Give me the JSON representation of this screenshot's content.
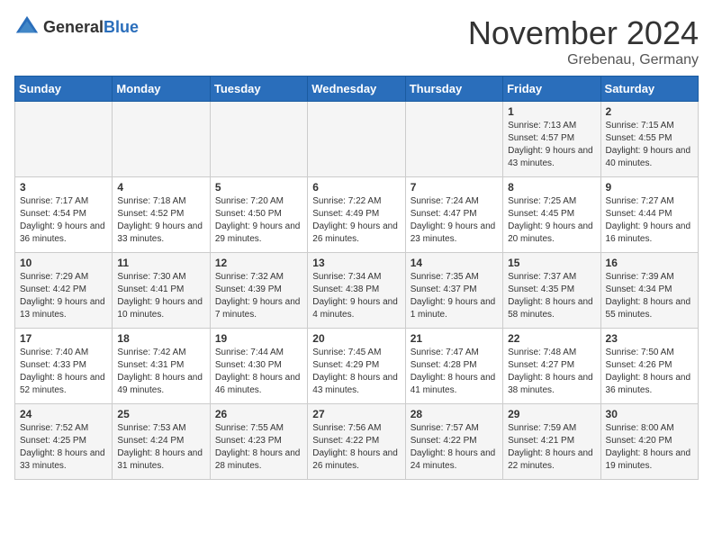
{
  "header": {
    "logo_general": "General",
    "logo_blue": "Blue",
    "month": "November 2024",
    "location": "Grebenau, Germany"
  },
  "weekdays": [
    "Sunday",
    "Monday",
    "Tuesday",
    "Wednesday",
    "Thursday",
    "Friday",
    "Saturday"
  ],
  "weeks": [
    [
      {
        "day": "",
        "sunrise": "",
        "sunset": "",
        "daylight": ""
      },
      {
        "day": "",
        "sunrise": "",
        "sunset": "",
        "daylight": ""
      },
      {
        "day": "",
        "sunrise": "",
        "sunset": "",
        "daylight": ""
      },
      {
        "day": "",
        "sunrise": "",
        "sunset": "",
        "daylight": ""
      },
      {
        "day": "",
        "sunrise": "",
        "sunset": "",
        "daylight": ""
      },
      {
        "day": "1",
        "sunrise": "Sunrise: 7:13 AM",
        "sunset": "Sunset: 4:57 PM",
        "daylight": "Daylight: 9 hours and 43 minutes."
      },
      {
        "day": "2",
        "sunrise": "Sunrise: 7:15 AM",
        "sunset": "Sunset: 4:55 PM",
        "daylight": "Daylight: 9 hours and 40 minutes."
      }
    ],
    [
      {
        "day": "3",
        "sunrise": "Sunrise: 7:17 AM",
        "sunset": "Sunset: 4:54 PM",
        "daylight": "Daylight: 9 hours and 36 minutes."
      },
      {
        "day": "4",
        "sunrise": "Sunrise: 7:18 AM",
        "sunset": "Sunset: 4:52 PM",
        "daylight": "Daylight: 9 hours and 33 minutes."
      },
      {
        "day": "5",
        "sunrise": "Sunrise: 7:20 AM",
        "sunset": "Sunset: 4:50 PM",
        "daylight": "Daylight: 9 hours and 29 minutes."
      },
      {
        "day": "6",
        "sunrise": "Sunrise: 7:22 AM",
        "sunset": "Sunset: 4:49 PM",
        "daylight": "Daylight: 9 hours and 26 minutes."
      },
      {
        "day": "7",
        "sunrise": "Sunrise: 7:24 AM",
        "sunset": "Sunset: 4:47 PM",
        "daylight": "Daylight: 9 hours and 23 minutes."
      },
      {
        "day": "8",
        "sunrise": "Sunrise: 7:25 AM",
        "sunset": "Sunset: 4:45 PM",
        "daylight": "Daylight: 9 hours and 20 minutes."
      },
      {
        "day": "9",
        "sunrise": "Sunrise: 7:27 AM",
        "sunset": "Sunset: 4:44 PM",
        "daylight": "Daylight: 9 hours and 16 minutes."
      }
    ],
    [
      {
        "day": "10",
        "sunrise": "Sunrise: 7:29 AM",
        "sunset": "Sunset: 4:42 PM",
        "daylight": "Daylight: 9 hours and 13 minutes."
      },
      {
        "day": "11",
        "sunrise": "Sunrise: 7:30 AM",
        "sunset": "Sunset: 4:41 PM",
        "daylight": "Daylight: 9 hours and 10 minutes."
      },
      {
        "day": "12",
        "sunrise": "Sunrise: 7:32 AM",
        "sunset": "Sunset: 4:39 PM",
        "daylight": "Daylight: 9 hours and 7 minutes."
      },
      {
        "day": "13",
        "sunrise": "Sunrise: 7:34 AM",
        "sunset": "Sunset: 4:38 PM",
        "daylight": "Daylight: 9 hours and 4 minutes."
      },
      {
        "day": "14",
        "sunrise": "Sunrise: 7:35 AM",
        "sunset": "Sunset: 4:37 PM",
        "daylight": "Daylight: 9 hours and 1 minute."
      },
      {
        "day": "15",
        "sunrise": "Sunrise: 7:37 AM",
        "sunset": "Sunset: 4:35 PM",
        "daylight": "Daylight: 8 hours and 58 minutes."
      },
      {
        "day": "16",
        "sunrise": "Sunrise: 7:39 AM",
        "sunset": "Sunset: 4:34 PM",
        "daylight": "Daylight: 8 hours and 55 minutes."
      }
    ],
    [
      {
        "day": "17",
        "sunrise": "Sunrise: 7:40 AM",
        "sunset": "Sunset: 4:33 PM",
        "daylight": "Daylight: 8 hours and 52 minutes."
      },
      {
        "day": "18",
        "sunrise": "Sunrise: 7:42 AM",
        "sunset": "Sunset: 4:31 PM",
        "daylight": "Daylight: 8 hours and 49 minutes."
      },
      {
        "day": "19",
        "sunrise": "Sunrise: 7:44 AM",
        "sunset": "Sunset: 4:30 PM",
        "daylight": "Daylight: 8 hours and 46 minutes."
      },
      {
        "day": "20",
        "sunrise": "Sunrise: 7:45 AM",
        "sunset": "Sunset: 4:29 PM",
        "daylight": "Daylight: 8 hours and 43 minutes."
      },
      {
        "day": "21",
        "sunrise": "Sunrise: 7:47 AM",
        "sunset": "Sunset: 4:28 PM",
        "daylight": "Daylight: 8 hours and 41 minutes."
      },
      {
        "day": "22",
        "sunrise": "Sunrise: 7:48 AM",
        "sunset": "Sunset: 4:27 PM",
        "daylight": "Daylight: 8 hours and 38 minutes."
      },
      {
        "day": "23",
        "sunrise": "Sunrise: 7:50 AM",
        "sunset": "Sunset: 4:26 PM",
        "daylight": "Daylight: 8 hours and 36 minutes."
      }
    ],
    [
      {
        "day": "24",
        "sunrise": "Sunrise: 7:52 AM",
        "sunset": "Sunset: 4:25 PM",
        "daylight": "Daylight: 8 hours and 33 minutes."
      },
      {
        "day": "25",
        "sunrise": "Sunrise: 7:53 AM",
        "sunset": "Sunset: 4:24 PM",
        "daylight": "Daylight: 8 hours and 31 minutes."
      },
      {
        "day": "26",
        "sunrise": "Sunrise: 7:55 AM",
        "sunset": "Sunset: 4:23 PM",
        "daylight": "Daylight: 8 hours and 28 minutes."
      },
      {
        "day": "27",
        "sunrise": "Sunrise: 7:56 AM",
        "sunset": "Sunset: 4:22 PM",
        "daylight": "Daylight: 8 hours and 26 minutes."
      },
      {
        "day": "28",
        "sunrise": "Sunrise: 7:57 AM",
        "sunset": "Sunset: 4:22 PM",
        "daylight": "Daylight: 8 hours and 24 minutes."
      },
      {
        "day": "29",
        "sunrise": "Sunrise: 7:59 AM",
        "sunset": "Sunset: 4:21 PM",
        "daylight": "Daylight: 8 hours and 22 minutes."
      },
      {
        "day": "30",
        "sunrise": "Sunrise: 8:00 AM",
        "sunset": "Sunset: 4:20 PM",
        "daylight": "Daylight: 8 hours and 19 minutes."
      }
    ]
  ]
}
